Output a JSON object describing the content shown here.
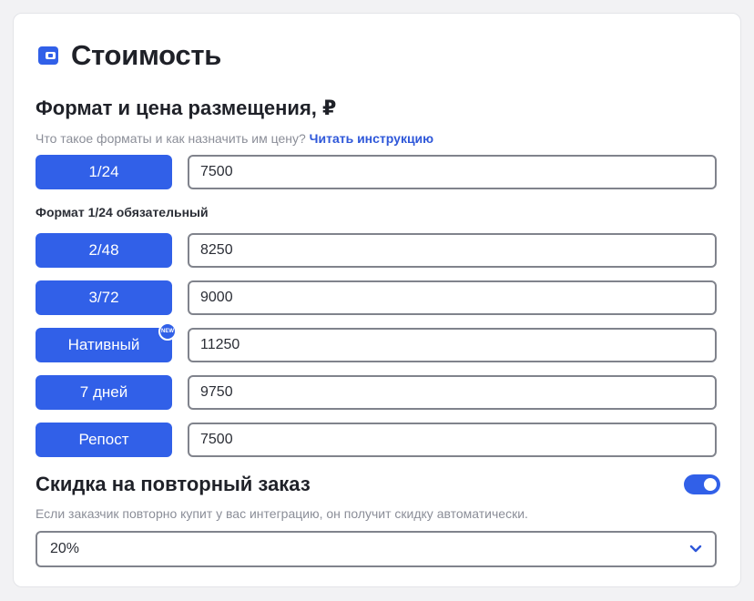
{
  "page": {
    "title": "Стоимость",
    "format_section": {
      "heading": "Формат и цена размещения, ₽",
      "hint_text": "Что такое форматы и как назначить им цену?",
      "hint_link": "Читать инструкцию",
      "required_note": "Формат 1/24 обязательный"
    },
    "formats": [
      {
        "label": "1/24",
        "price": "7500",
        "badge": ""
      },
      {
        "label": "2/48",
        "price": "8250",
        "badge": ""
      },
      {
        "label": "3/72",
        "price": "9000",
        "badge": ""
      },
      {
        "label": "Нативный",
        "price": "11250",
        "badge": "NEW"
      },
      {
        "label": "7 дней",
        "price": "9750",
        "badge": ""
      },
      {
        "label": "Репост",
        "price": "7500",
        "badge": ""
      }
    ],
    "discount": {
      "heading": "Скидка на повторный заказ",
      "enabled": true,
      "description": "Если заказчик повторно купит у вас интеграцию, он получит скидку автоматически.",
      "selected": "20%"
    }
  },
  "icons": {
    "header": "wallet-icon",
    "select": "chevron-down-icon"
  },
  "colors": {
    "accent": "#3160e8",
    "link": "#2e57d9",
    "border": "#80838c",
    "muted_text": "#8b8e98"
  }
}
